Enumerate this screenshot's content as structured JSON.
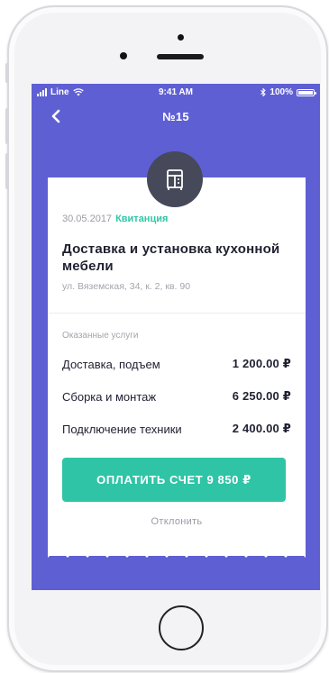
{
  "status_bar": {
    "carrier": "Line",
    "time": "9:41 AM",
    "battery": "100%"
  },
  "nav": {
    "title": "№15"
  },
  "receipt": {
    "date": "30.05.2017",
    "type_tag": "Квитанция",
    "title": "Доставка и установка кухонной мебели",
    "address": "ул. Вяземская, 34, к. 2, кв. 90",
    "services_label": "Оказанные услуги",
    "services": [
      {
        "name": "Доставка, подъем",
        "price": "1 200.00 ₽"
      },
      {
        "name": "Сборка и монтаж",
        "price": "6 250.00 ₽"
      },
      {
        "name": "Подключение техники",
        "price": "2 400.00 ₽"
      }
    ],
    "pay_button": "ОПЛАТИТЬ СЧЕТ 9 850 ₽",
    "decline_link": "Отклонить"
  },
  "colors": {
    "screen_bg": "#5f5fd4",
    "accent": "#2fc4a6",
    "icon_circle": "#46495a"
  },
  "icons": {
    "back": "chevron-left-icon",
    "receipt": "furniture-cabinet-icon",
    "wifi": "wifi-icon",
    "bluetooth": "bluetooth-icon",
    "battery": "battery-icon"
  }
}
